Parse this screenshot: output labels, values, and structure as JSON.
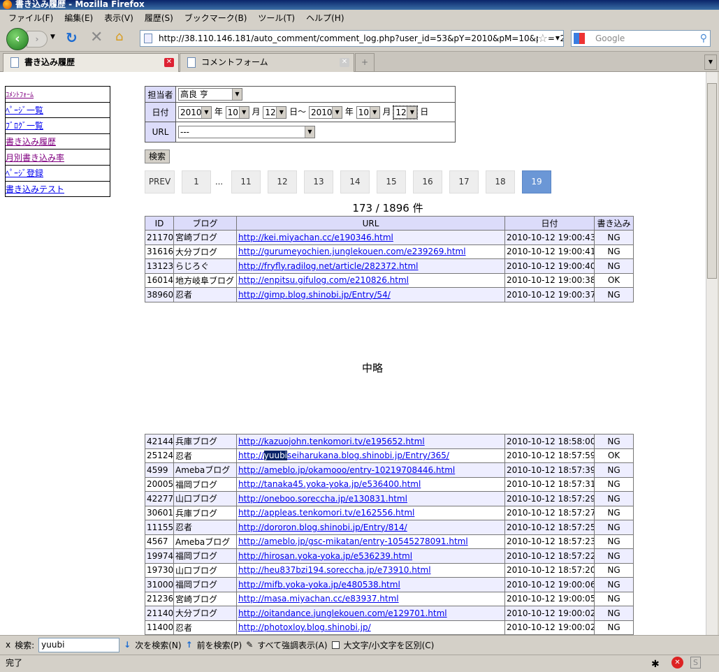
{
  "window": {
    "title": "書き込み履歴 - Mozilla Firefox"
  },
  "menu": [
    "ファイル(F)",
    "編集(E)",
    "表示(V)",
    "履歴(S)",
    "ブックマーク(B)",
    "ツール(T)",
    "ヘルプ(H)"
  ],
  "nav": {
    "url": "http://38.110.146.181/auto_comment/comment_log.php?user_id=53&pY=2010&pM=10&pD=12&fY=2010&fM=",
    "search_placeholder": "Google"
  },
  "tabs": [
    {
      "label": "書き込み履歴",
      "active": true
    },
    {
      "label": "コメントフォーム",
      "active": false
    }
  ],
  "sidebar": [
    {
      "label": "ｺﾒﾝﾄﾌｫｰﾑ",
      "visited": true
    },
    {
      "label": "ﾍﾟｰｼﾞ一覧"
    },
    {
      "label": "ﾌﾞﾛｸﾞ一覧"
    },
    {
      "label": "書き込み履歴",
      "visited": true
    },
    {
      "label": "月別書き込み率",
      "visited": true
    },
    {
      "label": "ﾍﾟｰｼﾞ登録"
    },
    {
      "label": "書き込みテスト"
    }
  ],
  "form": {
    "person_label": "担当者",
    "person_value": "高良 亨",
    "date_label": "日付",
    "from_year": "2010",
    "from_month": "10",
    "from_day": "12",
    "to_year": "2010",
    "to_month": "10",
    "to_day": "12",
    "year_unit": "年",
    "month_unit": "月",
    "day_unit": "日",
    "range_sep": "日～",
    "url_label": "URL",
    "url_value": "---",
    "search_button": "検索"
  },
  "pagination": {
    "prev": "PREV",
    "pages": [
      "1",
      "…",
      "11",
      "12",
      "13",
      "14",
      "15",
      "16",
      "17",
      "18",
      "19"
    ],
    "current": "19"
  },
  "count": "173 / 1896 件",
  "table": {
    "headers": [
      "ID",
      "ブログ",
      "URL",
      "日付",
      "書き込み"
    ],
    "rows_top": [
      [
        "21170",
        "宮崎ブログ",
        "http://kei.miyachan.cc/e190346.html",
        "2010-10-12 19:00:43",
        "NG"
      ],
      [
        "31616",
        "大分ブログ",
        "http://gurumeyochien.junglekouen.com/e239269.html",
        "2010-10-12 19:00:41",
        "NG"
      ],
      [
        "13123",
        "らじろぐ",
        "http://fryfly.radilog.net/article/282372.html",
        "2010-10-12 19:00:40",
        "NG"
      ],
      [
        "16014",
        "地方岐阜ブログ",
        "http://enpitsu.gifulog.com/e210826.html",
        "2010-10-12 19:00:38",
        "OK"
      ],
      [
        "38960",
        "忍者",
        "http://gimp.blog.shinobi.jp/Entry/54/",
        "2010-10-12 19:00:37",
        "NG"
      ]
    ],
    "omitted": "中略",
    "rows_bottom": [
      [
        "42144",
        "兵庫ブログ",
        "http://kazuojohn.tenkomori.tv/e195652.html",
        "2010-10-12 18:58:00",
        "NG"
      ],
      [
        "25124",
        "忍者",
        "http://yuubiseiharukana.blog.shinobi.jp/Entry/365/",
        "2010-10-12 18:57:59",
        "OK"
      ],
      [
        "4599",
        "Amebaブログ",
        "http://ameblo.jp/okamooo/entry-10219708446.html",
        "2010-10-12 18:57:39",
        "NG"
      ],
      [
        "20005",
        "福岡ブログ",
        "http://tanaka45.yoka-yoka.jp/e536400.html",
        "2010-10-12 18:57:31",
        "NG"
      ],
      [
        "42277",
        "山口ブログ",
        "http://oneboo.soreccha.jp/e130831.html",
        "2010-10-12 18:57:29",
        "NG"
      ],
      [
        "30601",
        "兵庫ブログ",
        "http://appleas.tenkomori.tv/e162556.html",
        "2010-10-12 18:57:27",
        "NG"
      ],
      [
        "11155",
        "忍者",
        "http://dororon.blog.shinobi.jp/Entry/814/",
        "2010-10-12 18:57:25",
        "NG"
      ],
      [
        "4567",
        "Amebaブログ",
        "http://ameblo.jp/gsc-mikatan/entry-10545278091.html",
        "2010-10-12 18:57:23",
        "NG"
      ],
      [
        "19974",
        "福岡ブログ",
        "http://hirosan.yoka-yoka.jp/e536239.html",
        "2010-10-12 18:57:22",
        "NG"
      ],
      [
        "19730",
        "山口ブログ",
        "http://heu837bzi194.soreccha.jp/e73910.html",
        "2010-10-12 18:57:20",
        "NG"
      ],
      [
        "31000",
        "福岡ブログ",
        "http://mifb.yoka-yoka.jp/e480538.html",
        "2010-10-12 19:00:06",
        "NG"
      ],
      [
        "21236",
        "宮崎ブログ",
        "http://masa.miyachan.cc/e83937.html",
        "2010-10-12 19:00:05",
        "NG"
      ],
      [
        "21140",
        "大分ブログ",
        "http://oitandance.junglekouen.com/e129701.html",
        "2010-10-12 19:00:02",
        "NG"
      ],
      [
        "11400",
        "忍者",
        "http://photoxloy.blog.shinobi.jp/",
        "2010-10-12 19:00:02",
        "NG"
      ]
    ]
  },
  "findbar": {
    "close": "x",
    "label": "検索:",
    "value": "yuubi",
    "next": "次を検索(N)",
    "prev": "前を検索(P)",
    "highlight": "すべて強調表示(A)",
    "match_case": "大文字/小文字を区別(C)"
  },
  "status": "完了"
}
